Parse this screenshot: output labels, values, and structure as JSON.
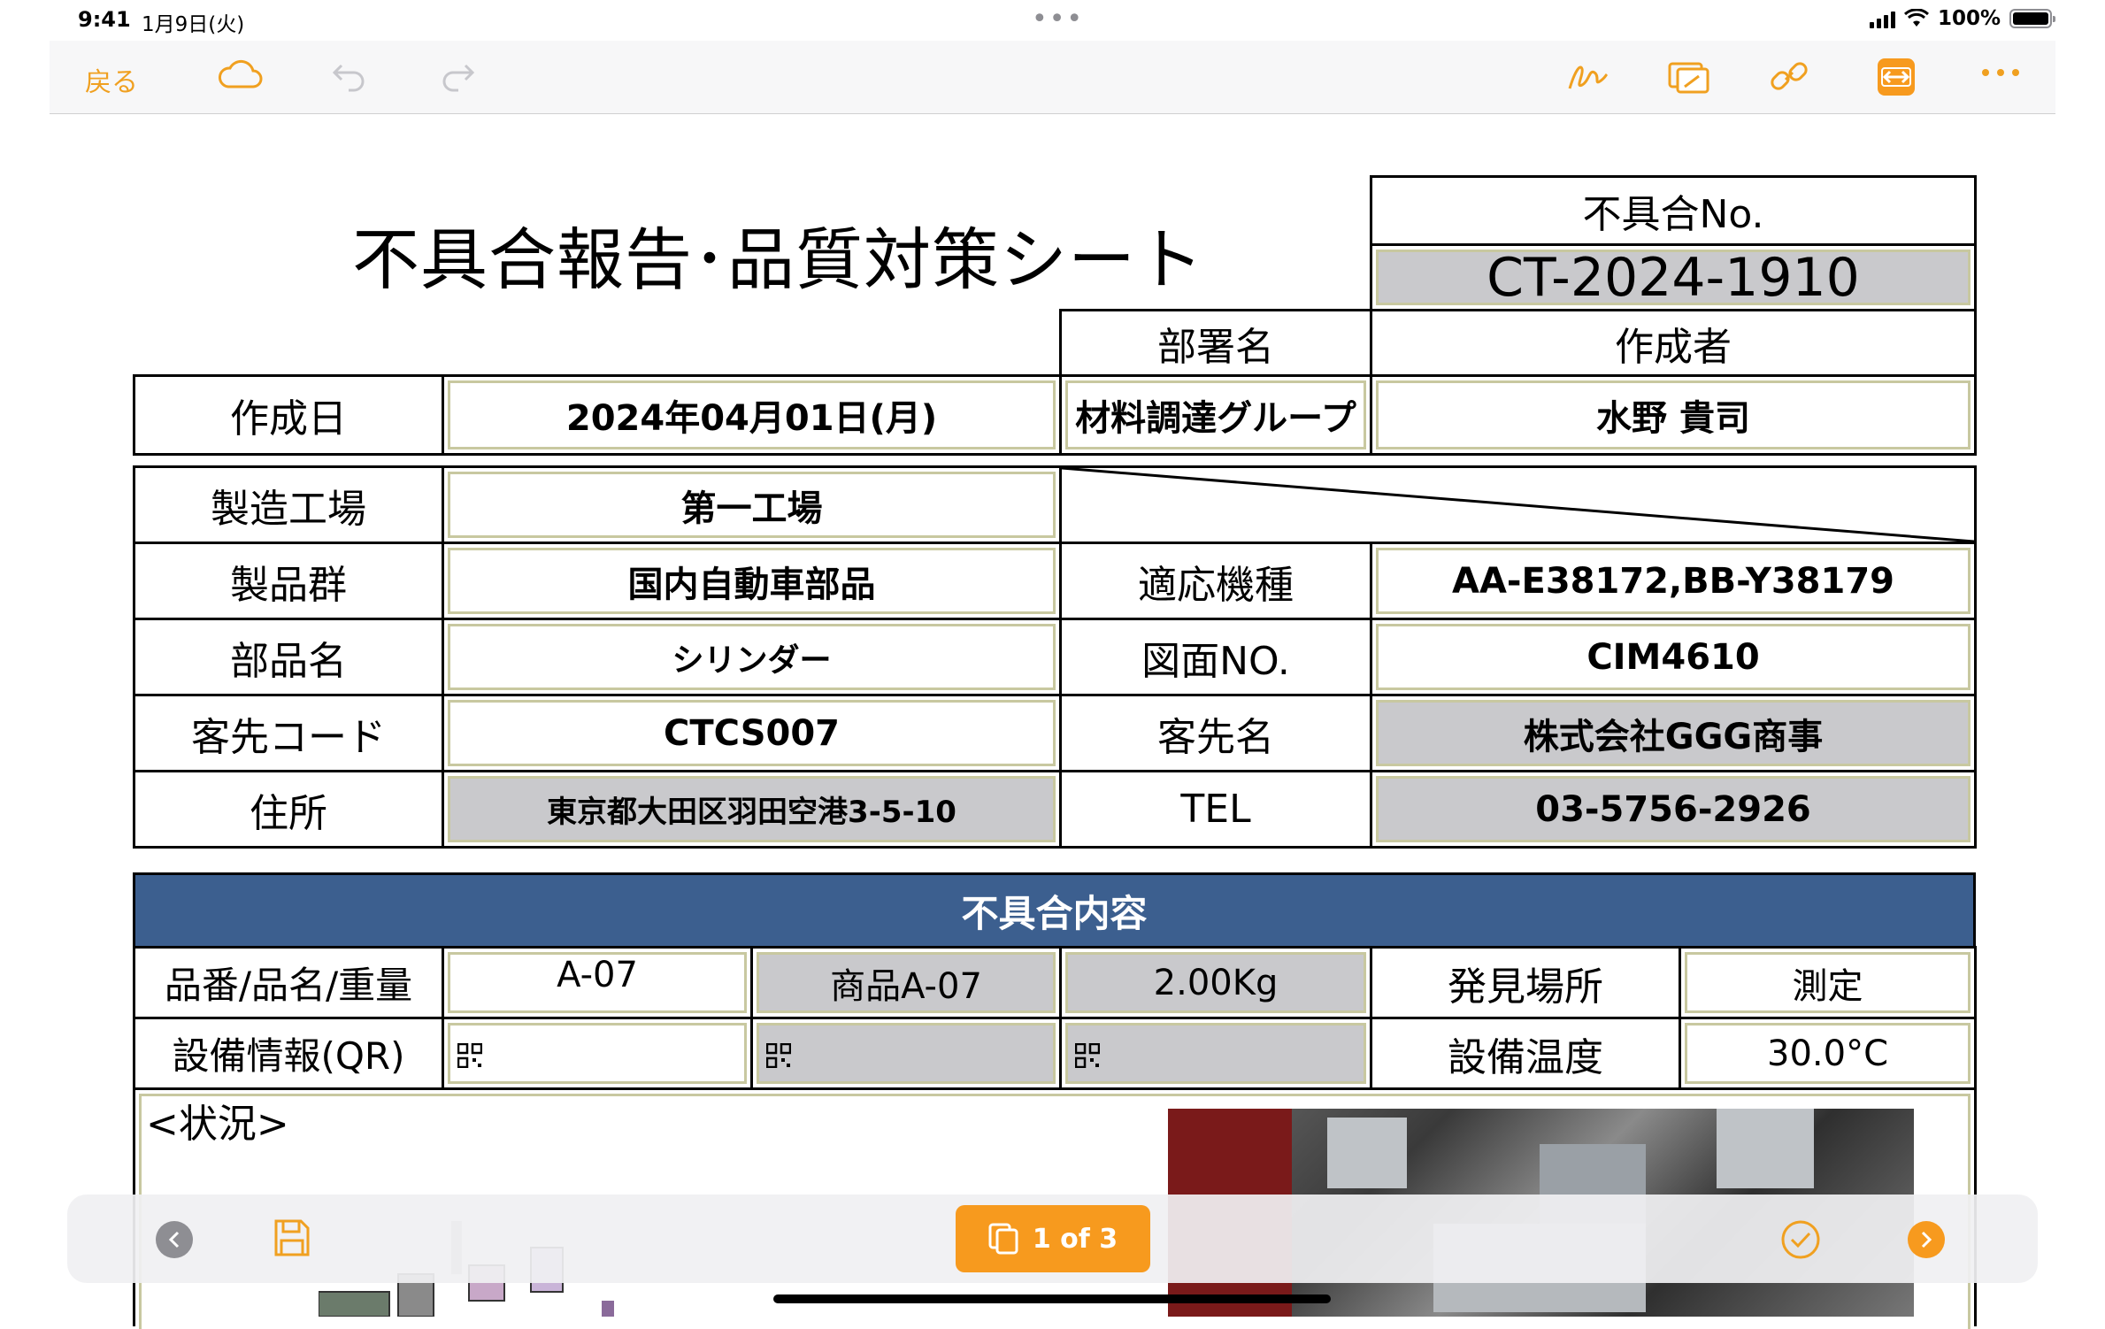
{
  "status_bar": {
    "time": "9:41",
    "date": "1月9日(火)",
    "dots": "•••",
    "battery_percent": "100%"
  },
  "toolbar": {
    "back_label": "戻る",
    "icons": [
      "cloud-icon",
      "undo-icon",
      "redo-icon",
      "signature-icon",
      "annotate-icon",
      "link-icon",
      "resize-icon",
      "more-icon"
    ]
  },
  "document": {
    "title": "不具合報告･品質対策シート",
    "defect_no_label": "不具合No.",
    "defect_no": "CT-2024-1910",
    "dept_label": "部署名",
    "author_label": "作成者",
    "created_label": "作成日",
    "created_value": "2024年04月01日(月)",
    "dept_value": "材料調達グループ",
    "author_value": "水野 貴司",
    "rows": [
      {
        "label": "製造工場",
        "value": "第一工場"
      },
      {
        "label": "製品群",
        "value": "国内自動車部品",
        "label2": "適応機種",
        "value2": "AA-E38172,BB-Y38179"
      },
      {
        "label": "部品名",
        "value": "シリンダー",
        "label2": "図面NO.",
        "value2": "CIM4610"
      },
      {
        "label": "客先コード",
        "value": "CTCS007",
        "label2": "客先名",
        "value2": "株式会社GGG商事"
      },
      {
        "label": "住所",
        "value": "東京都大田区羽田空港3-5-10",
        "label2": "TEL",
        "value2": "03-5756-2926"
      }
    ],
    "defect_header": "不具合内容",
    "item_label": "品番/品名/重量",
    "item_no": "A-07",
    "item_name": "商品A-07",
    "item_weight": "2.00Kg",
    "found_label": "発見場所",
    "found_value": "測定",
    "equip_label": "設備情報(QR)",
    "temp_label": "設備温度",
    "temp_value": "30.0°C",
    "situation_label": "<状況>"
  },
  "bottom_bar": {
    "page_indicator": "1 of 3"
  },
  "colors": {
    "accent": "#f79a1e",
    "header_band": "#3c5f8f",
    "grey_cell": "#c9c9cc"
  }
}
